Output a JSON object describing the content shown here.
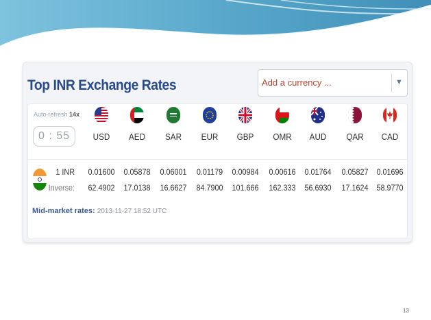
{
  "widget": {
    "title": "Top INR Exchange Rates",
    "add_currency_placeholder": "Add a currency ...",
    "auto_refresh_label": "Auto-refresh",
    "auto_refresh_interval": "14x",
    "timer": "0 : 55"
  },
  "currencies": [
    {
      "code": "USD",
      "flag_icon": "us-flag-icon",
      "per_inr": "0.01600",
      "inverse": "62.4902"
    },
    {
      "code": "AED",
      "flag_icon": "uae-flag-icon",
      "per_inr": "0.05878",
      "inverse": "17.0138"
    },
    {
      "code": "SAR",
      "flag_icon": "saudi-flag-icon",
      "per_inr": "0.06001",
      "inverse": "16.6627"
    },
    {
      "code": "EUR",
      "flag_icon": "eu-flag-icon",
      "per_inr": "0.01179",
      "inverse": "84.7900"
    },
    {
      "code": "GBP",
      "flag_icon": "uk-flag-icon",
      "per_inr": "0.00984",
      "inverse": "101.666"
    },
    {
      "code": "OMR",
      "flag_icon": "oman-flag-icon",
      "per_inr": "0.00616",
      "inverse": "162.333"
    },
    {
      "code": "AUD",
      "flag_icon": "australia-flag-icon",
      "per_inr": "0.01764",
      "inverse": "56.6930"
    },
    {
      "code": "QAR",
      "flag_icon": "qatar-flag-icon",
      "per_inr": "0.05827",
      "inverse": "17.1624"
    },
    {
      "code": "CAD",
      "flag_icon": "canada-flag-icon",
      "per_inr": "0.01696",
      "inverse": "58.9770"
    }
  ],
  "rows": {
    "base_label": "1 INR",
    "inverse_label": "Inverse:"
  },
  "footer": {
    "mid_label": "Mid-market rates:",
    "timestamp": "2013-11-27 18:52 UTC"
  },
  "slide": {
    "page_number": "13"
  },
  "colors": {
    "title": "#274a8c",
    "placeholder": "#b5442f",
    "header_wave": "#5fa8c8"
  }
}
